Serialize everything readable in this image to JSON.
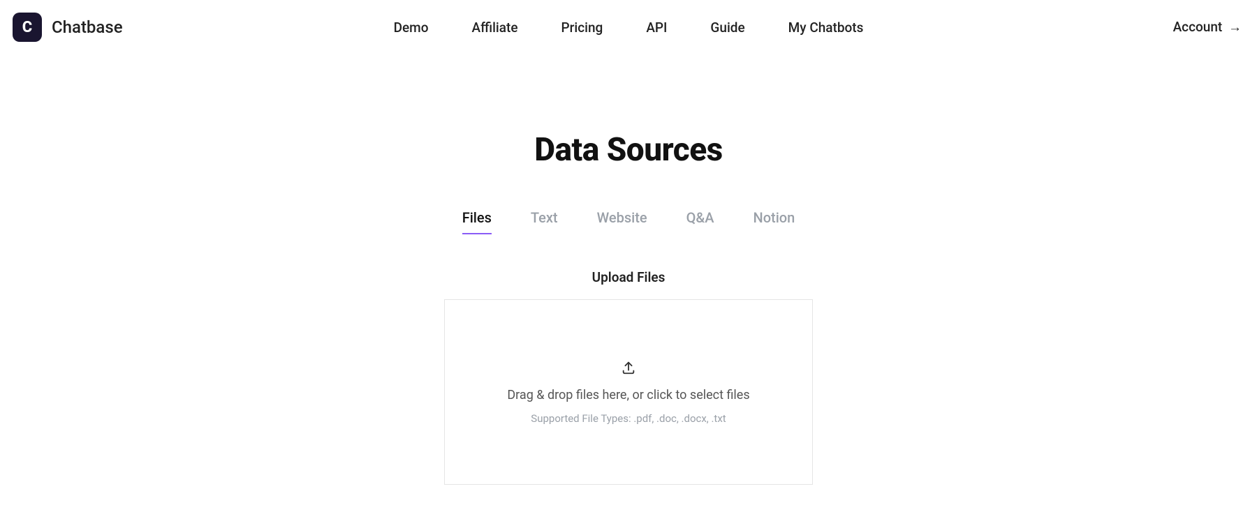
{
  "brand": {
    "logo_letter": "C",
    "name": "Chatbase"
  },
  "nav": {
    "items": [
      {
        "label": "Demo"
      },
      {
        "label": "Affiliate"
      },
      {
        "label": "Pricing"
      },
      {
        "label": "API"
      },
      {
        "label": "Guide"
      },
      {
        "label": "My Chatbots"
      }
    ],
    "account_label": "Account",
    "account_arrow": "→"
  },
  "page": {
    "title": "Data Sources",
    "tabs": [
      {
        "label": "Files",
        "active": true
      },
      {
        "label": "Text",
        "active": false
      },
      {
        "label": "Website",
        "active": false
      },
      {
        "label": "Q&A",
        "active": false
      },
      {
        "label": "Notion",
        "active": false
      }
    ],
    "upload": {
      "section_label": "Upload Files",
      "drop_text": "Drag & drop files here, or click to select files",
      "supported_text": "Supported File Types: .pdf, .doc, .docx, .txt"
    }
  }
}
